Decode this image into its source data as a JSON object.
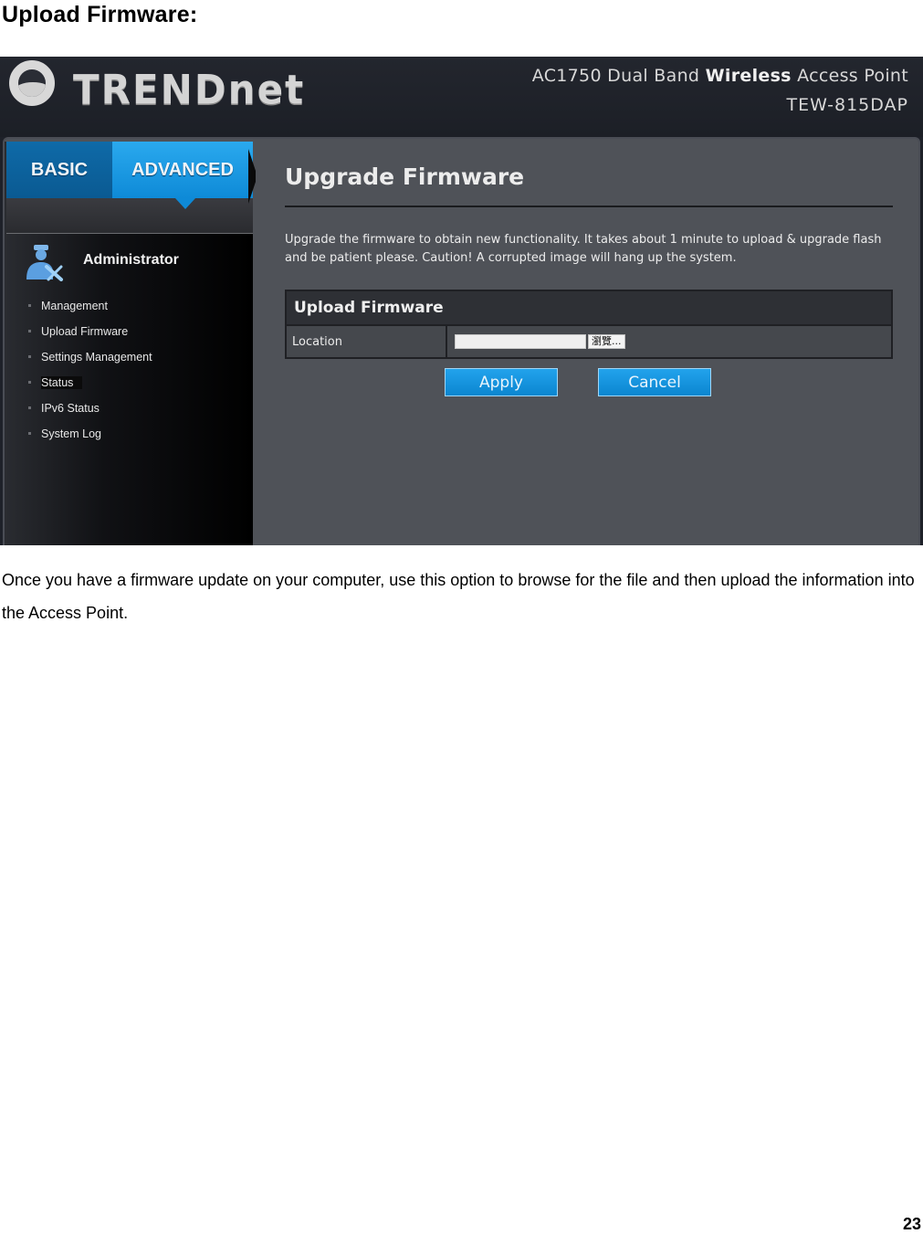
{
  "document": {
    "heading": "Upload Firmware:",
    "body_text": "Once you have a firmware update on your computer, use this option to browse for the file and then upload the information into the Access Point.",
    "page_number": "23"
  },
  "screenshot": {
    "header": {
      "logo": "TRENDnet",
      "product_prefix": "AC1750 Dual Band ",
      "product_bold": "Wireless",
      "product_suffix": " Access Point",
      "model": "TEW-815DAP"
    },
    "tabs": [
      {
        "label": "BASIC",
        "active": false
      },
      {
        "label": "ADVANCED",
        "active": true
      }
    ],
    "sidebar": {
      "section_icon": "administrator-icon",
      "section_label": "Administrator",
      "items": [
        {
          "label": "Management"
        },
        {
          "label": "Upload Firmware"
        },
        {
          "label": "Settings Management"
        },
        {
          "label": "Status"
        },
        {
          "label": "IPv6 Status"
        },
        {
          "label": "System Log"
        }
      ]
    },
    "main": {
      "title": "Upgrade Firmware",
      "description": "Upgrade the firmware to obtain new functionality. It takes about 1 minute to upload & upgrade flash and be patient please. Caution! A corrupted image will hang up the system.",
      "table": {
        "header": "Upload Firmware",
        "rows": [
          {
            "label": "Location",
            "value": "",
            "browse_label": "瀏覽..."
          }
        ]
      },
      "buttons": {
        "apply": "Apply",
        "cancel": "Cancel"
      }
    },
    "colors": {
      "accent_blue": "#0e8ad7",
      "basic_tab": "#0a5a92",
      "content_bg": "#4f5258",
      "header_bg": "#1e2129"
    }
  }
}
